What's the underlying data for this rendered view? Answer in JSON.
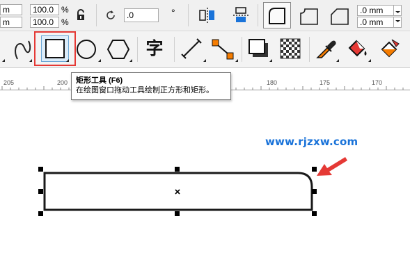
{
  "propbar": {
    "width_unit_partial": "m",
    "height_unit_partial": "m",
    "scale_x": "100.0",
    "scale_y": "100.0",
    "percent_symbol": "%",
    "rotation_value": ".0",
    "degree_symbol": "°",
    "corner_radius_top": ".0 mm",
    "corner_radius_bottom": ".0 mm"
  },
  "toolbar": {
    "tools": [
      "freehand-tool",
      "rectangle-tool",
      "ellipse-tool",
      "polygon-tool",
      "text-tool",
      "dimension-tool",
      "connector-tool",
      "drop-shadow-tool",
      "transparency-tool",
      "eyedropper-tool",
      "fill-tool",
      "smart-fill-tool"
    ],
    "active_tool": "rectangle-tool",
    "highlight_color": "#e53935",
    "text_tool_glyph": "字"
  },
  "ruler": {
    "labels": [
      "205",
      "200",
      "180",
      "175",
      "170"
    ]
  },
  "tooltip": {
    "title": "矩形工具 (F6)",
    "description": "在绘图窗口拖动工具绘制正方形和矩形。"
  },
  "canvas": {
    "watermark": "www.rjzxw.com",
    "shape": "rounded-rectangle",
    "rounded_corner": "top-right",
    "arrow_color": "#e53935"
  }
}
